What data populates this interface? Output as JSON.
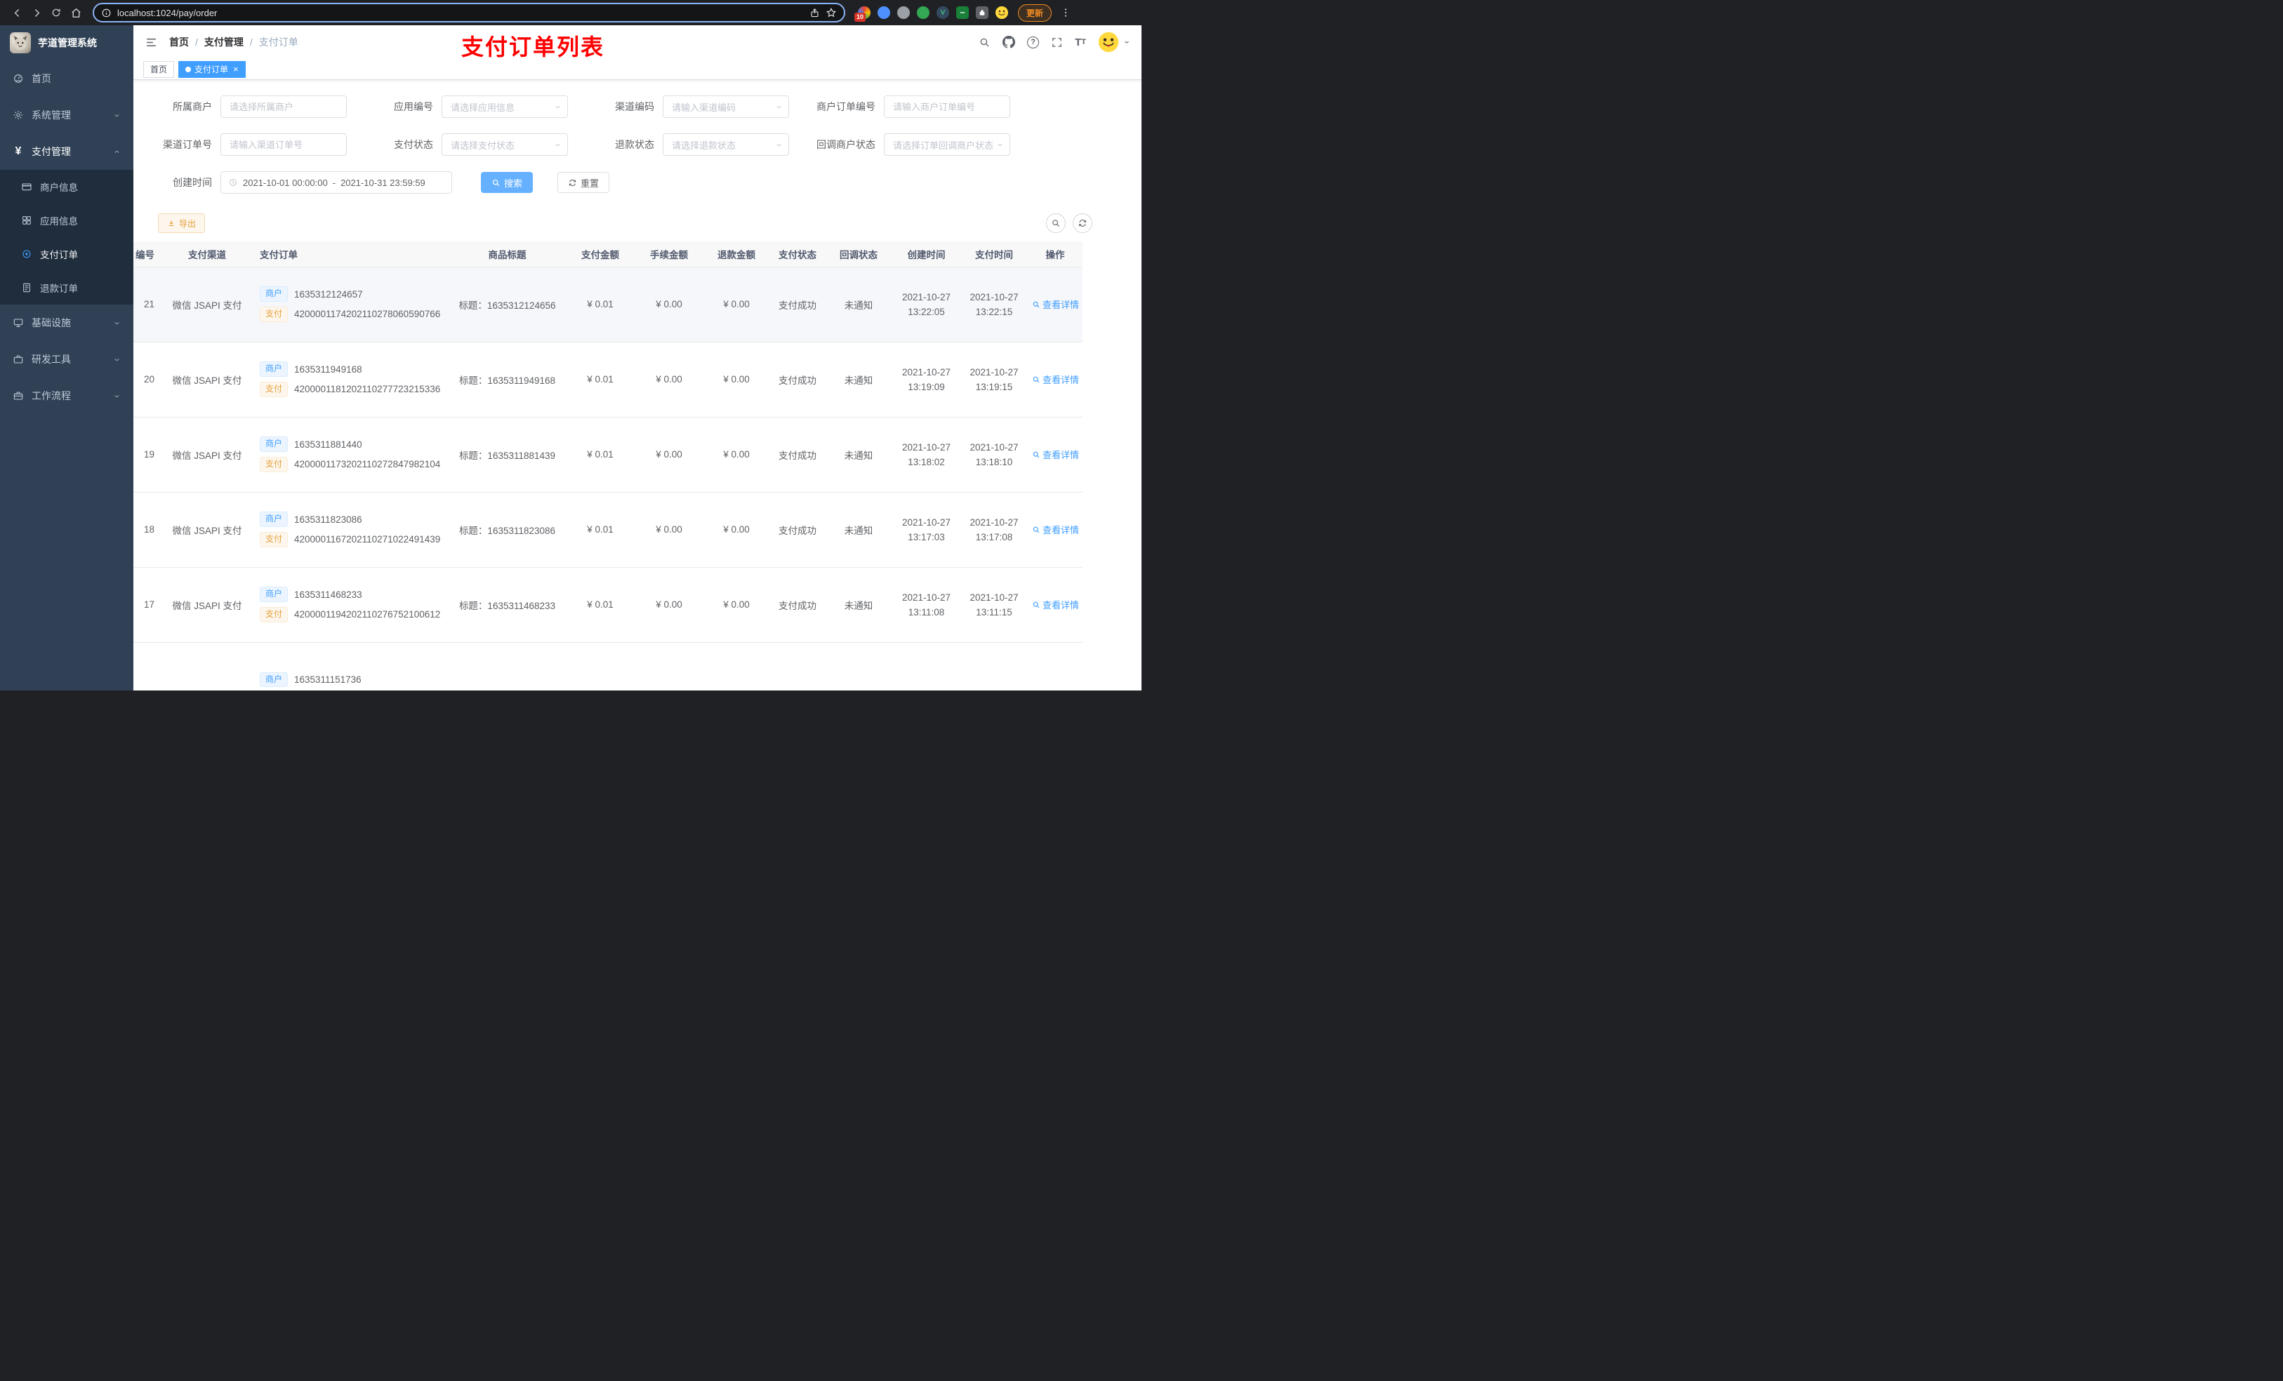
{
  "browser": {
    "url": "localhost:1024/pay/order",
    "update_label": "更新",
    "extension_badge": "10"
  },
  "sidebar": {
    "app_title": "芋道管理系统",
    "menu": {
      "home": "首页",
      "system": "系统管理",
      "payment": "支付管理",
      "merchant_info": "商户信息",
      "app_info": "应用信息",
      "pay_order": "支付订单",
      "refund_order": "退款订单",
      "infrastructure": "基础设施",
      "dev_tools": "研发工具",
      "workflow": "工作流程"
    }
  },
  "header": {
    "breadcrumbs": [
      "首页",
      "支付管理",
      "支付订单"
    ],
    "annotation": "支付订单列表"
  },
  "tabs": {
    "home": "首页",
    "current": "支付订单"
  },
  "filters": {
    "merchant": {
      "label": "所属商户",
      "placeholder": "请选择所属商户"
    },
    "app_no": {
      "label": "应用编号",
      "placeholder": "请选择应用信息"
    },
    "channel_code": {
      "label": "渠道编码",
      "placeholder": "请输入渠道编码"
    },
    "merchant_order_no": {
      "label": "商户订单编号",
      "placeholder": "请输入商户订单编号"
    },
    "channel_order_no": {
      "label": "渠道订单号",
      "placeholder": "请输入渠道订单号"
    },
    "pay_status": {
      "label": "支付状态",
      "placeholder": "请选择支付状态"
    },
    "refund_status": {
      "label": "退款状态",
      "placeholder": "请选择退款状态"
    },
    "notify_status": {
      "label": "回调商户状态",
      "placeholder": "请选择订单回调商户状态"
    },
    "create_time": {
      "label": "创建时间",
      "start": "2021-10-01 00:00:00",
      "separator": "-",
      "end": "2021-10-31 23:59:59"
    }
  },
  "actions": {
    "search": "搜索",
    "reset": "重置",
    "export": "导出"
  },
  "table": {
    "columns": [
      "编号",
      "支付渠道",
      "支付订单",
      "商品标题",
      "支付金额",
      "手续金额",
      "退款金额",
      "支付状态",
      "回调状态",
      "创建时间",
      "支付时间",
      "操作"
    ],
    "tag_merchant": "商户",
    "tag_pay": "支付",
    "rows": [
      {
        "id": "21",
        "channel": "微信 JSAPI 支付",
        "merchant_no": "1635312124657",
        "pay_no": "4200001174202110278060590766",
        "title": "标题：1635312124656",
        "amount": "¥ 0.01",
        "fee": "¥ 0.00",
        "refund": "¥ 0.00",
        "status": "支付成功",
        "notify": "未通知",
        "create_date": "2021-10-27",
        "create_time": "13:22:05",
        "pay_date": "2021-10-27",
        "pay_time": "13:22:15",
        "action": "查看详情"
      },
      {
        "id": "20",
        "channel": "微信 JSAPI 支付",
        "merchant_no": "1635311949168",
        "pay_no": "4200001181202110277723215336",
        "title": "标题：1635311949168",
        "amount": "¥ 0.01",
        "fee": "¥ 0.00",
        "refund": "¥ 0.00",
        "status": "支付成功",
        "notify": "未通知",
        "create_date": "2021-10-27",
        "create_time": "13:19:09",
        "pay_date": "2021-10-27",
        "pay_time": "13:19:15",
        "action": "查看详情"
      },
      {
        "id": "19",
        "channel": "微信 JSAPI 支付",
        "merchant_no": "1635311881440",
        "pay_no": "4200001173202110272847982104",
        "title": "标题：1635311881439",
        "amount": "¥ 0.01",
        "fee": "¥ 0.00",
        "refund": "¥ 0.00",
        "status": "支付成功",
        "notify": "未通知",
        "create_date": "2021-10-27",
        "create_time": "13:18:02",
        "pay_date": "2021-10-27",
        "pay_time": "13:18:10",
        "action": "查看详情"
      },
      {
        "id": "18",
        "channel": "微信 JSAPI 支付",
        "merchant_no": "1635311823086",
        "pay_no": "4200001167202110271022491439",
        "title": "标题：1635311823086",
        "amount": "¥ 0.01",
        "fee": "¥ 0.00",
        "refund": "¥ 0.00",
        "status": "支付成功",
        "notify": "未通知",
        "create_date": "2021-10-27",
        "create_time": "13:17:03",
        "pay_date": "2021-10-27",
        "pay_time": "13:17:08",
        "action": "查看详情"
      },
      {
        "id": "17",
        "channel": "微信 JSAPI 支付",
        "merchant_no": "1635311468233",
        "pay_no": "4200001194202110276752100612",
        "title": "标题：1635311468233",
        "amount": "¥ 0.01",
        "fee": "¥ 0.00",
        "refund": "¥ 0.00",
        "status": "支付成功",
        "notify": "未通知",
        "create_date": "2021-10-27",
        "create_time": "13:11:08",
        "pay_date": "2021-10-27",
        "pay_time": "13:11:15",
        "action": "查看详情"
      },
      {
        "id": "",
        "channel": "",
        "merchant_no": "1635311151736",
        "pay_no": "",
        "title": "",
        "amount": "",
        "fee": "",
        "refund": "",
        "status": "",
        "notify": "",
        "create_date": "",
        "create_time": "",
        "pay_date": "",
        "pay_time": "",
        "action": ""
      }
    ]
  },
  "colors": {
    "primary": "#409eff",
    "warning": "#e6a23c",
    "sidebar_bg": "#304156",
    "submenu_bg": "#1f2d3d",
    "annotation_red": "#fe0000",
    "active_tab": "#409eff"
  }
}
